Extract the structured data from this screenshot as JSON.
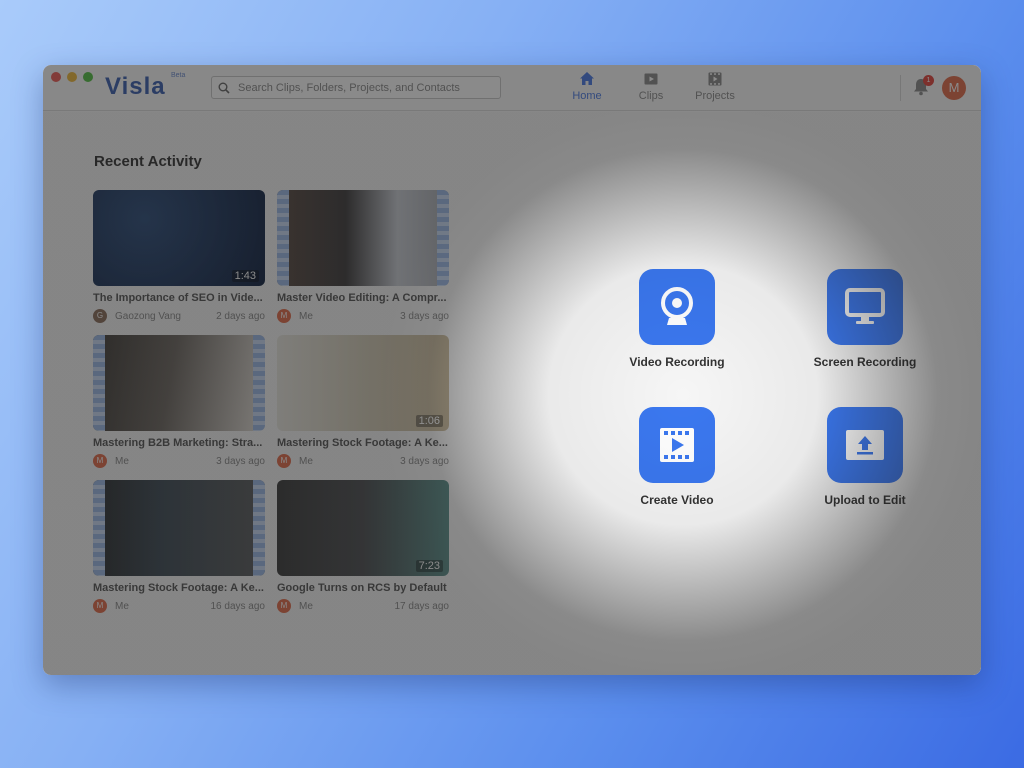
{
  "window": {
    "logo": "Visla",
    "logo_badge": "Beta",
    "search": {
      "placeholder": "Search Clips, Folders, Projects, and Contacts",
      "value": ""
    },
    "nav": [
      {
        "label": "Home",
        "icon": "home-icon",
        "active": true
      },
      {
        "label": "Clips",
        "icon": "clip-icon",
        "active": false
      },
      {
        "label": "Projects",
        "icon": "film-icon",
        "active": false
      }
    ],
    "notifications": {
      "count": "1"
    },
    "user_avatar": "M"
  },
  "recent_activity": {
    "title": "Recent Activity",
    "items": [
      {
        "title": "The Importance of SEO in Vide...",
        "author": "Gaozong Vang",
        "avatar": "G",
        "date": "2 days ago",
        "duration": "1:43"
      },
      {
        "title": "Master Video Editing: A Compr...",
        "author": "Me",
        "avatar": "M",
        "date": "3 days ago",
        "duration": ""
      },
      {
        "title": "Mastering B2B Marketing: Stra...",
        "author": "Me",
        "avatar": "M",
        "date": "3 days ago",
        "duration": ""
      },
      {
        "title": "Mastering Stock Footage: A Ke...",
        "author": "Me",
        "avatar": "M",
        "date": "3 days ago",
        "duration": "1:06"
      },
      {
        "title": "Mastering Stock Footage: A Ke...",
        "author": "Me",
        "avatar": "M",
        "date": "16 days ago",
        "duration": ""
      },
      {
        "title": "Google Turns on RCS by Default",
        "author": "Me",
        "avatar": "M",
        "date": "17 days ago",
        "duration": "7:23"
      }
    ]
  },
  "actions": [
    {
      "label": "Video Recording",
      "icon": "webcam-icon"
    },
    {
      "label": "Screen Recording",
      "icon": "monitor-icon"
    },
    {
      "label": "Create Video",
      "icon": "film-play-icon"
    },
    {
      "label": "Upload to Edit",
      "icon": "upload-icon"
    }
  ],
  "colors": {
    "accent": "#3b78f0",
    "avatar": "#e26b4a",
    "badge": "#e4433c"
  }
}
